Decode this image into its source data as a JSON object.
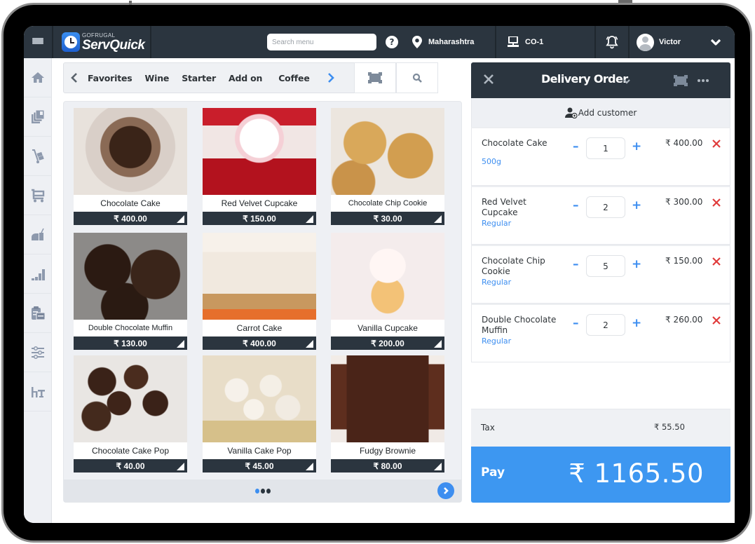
{
  "app": {
    "brand_top": "GOFRUGAL",
    "brand_name": "ServQuick"
  },
  "topbar": {
    "search_placeholder": "Search menu",
    "help_glyph": "?",
    "location": "Maharashtra",
    "terminal": "CO-1",
    "user_name": "Victor",
    "icons": [
      "hamburger-icon",
      "help-icon",
      "location-pin-icon",
      "terminal-icon",
      "bell-icon",
      "avatar",
      "chevron-down-icon"
    ]
  },
  "sidebar": {
    "items": [
      {
        "name": "home",
        "icon": "home-icon"
      },
      {
        "name": "catalog",
        "icon": "catalog-icon"
      },
      {
        "name": "delivery",
        "icon": "hand-truck-icon"
      },
      {
        "name": "purchase",
        "icon": "cart-icon"
      },
      {
        "name": "kitchen",
        "icon": "kitchen-icon"
      },
      {
        "name": "reports",
        "icon": "bar-steps-icon"
      },
      {
        "name": "billing",
        "icon": "clipboard-icon"
      },
      {
        "name": "settings",
        "icon": "sliders-icon"
      },
      {
        "name": "tables",
        "icon": "table-icon"
      }
    ]
  },
  "categories": {
    "items": [
      "Favorites",
      "Wine",
      "Starter",
      "Add on",
      "Coffee"
    ]
  },
  "products": [
    {
      "name": "Chocolate Cake",
      "price": "₹ 400.00",
      "theme": "choccake"
    },
    {
      "name": "Red Velvet Cupcake",
      "price": "₹ 150.00",
      "theme": "redvelvet"
    },
    {
      "name": "Chocolate Chip Cookie",
      "price": "₹ 30.00",
      "theme": "cookie"
    },
    {
      "name": "Double Chocolate Muffin",
      "price": "₹ 130.00",
      "theme": "muffin"
    },
    {
      "name": "Carrot Cake",
      "price": "₹ 400.00",
      "theme": "carrot"
    },
    {
      "name": "Vanilla Cupcake",
      "price": "₹ 200.00",
      "theme": "vanilla"
    },
    {
      "name": "Chocolate Cake Pop",
      "price": "₹ 40.00",
      "theme": "cakepop"
    },
    {
      "name": "Vanilla Cake Pop",
      "price": "₹ 45.00",
      "theme": "vanillapop"
    },
    {
      "name": "Fudgy Brownie",
      "price": "₹ 80.00",
      "theme": "brownie"
    }
  ],
  "pager": {
    "pages": 3,
    "current": 1
  },
  "order": {
    "title": "Delivery Order",
    "add_customer": "Add customer",
    "lines": [
      {
        "name": "Chocolate Cake",
        "variant": "500g",
        "qty": "1",
        "price": "₹ 400.00"
      },
      {
        "name": "Red Velvet Cupcake",
        "variant": "Regular",
        "qty": "2",
        "price": "₹ 300.00"
      },
      {
        "name": "Chocolate Chip Cookie",
        "variant": "Regular",
        "qty": "5",
        "price": "₹ 150.00"
      },
      {
        "name": "Double Chocolate Muffin",
        "variant": "Regular",
        "qty": "2",
        "price": "₹ 260.00"
      }
    ],
    "tax_label": "Tax",
    "tax_value": "₹ 55.50",
    "pay_label": "Pay",
    "total": "₹ 1165.50"
  },
  "colors": {
    "dark": "#2b353f",
    "accent": "#3d8ef0",
    "pay": "#3d97f1",
    "delete": "#e03c3c"
  }
}
